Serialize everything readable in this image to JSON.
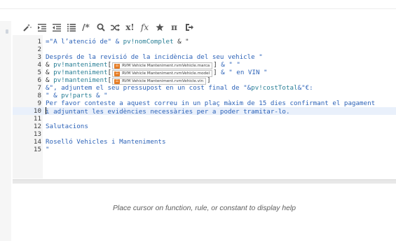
{
  "toolbar": {
    "buttons": [
      {
        "name": "magic-wand-icon",
        "label": ""
      },
      {
        "name": "indent-icon",
        "label": ""
      },
      {
        "name": "outdent-icon",
        "label": ""
      },
      {
        "name": "list-icon",
        "label": ""
      },
      {
        "name": "comment-button",
        "label": "/*"
      },
      {
        "name": "search-icon",
        "label": ""
      },
      {
        "name": "shuffle-icon",
        "label": ""
      },
      {
        "name": "factorial-button",
        "label": "x!"
      },
      {
        "name": "function-button",
        "label": "fx"
      },
      {
        "name": "star-icon",
        "label": ""
      },
      {
        "name": "pi-button",
        "label": "π"
      },
      {
        "name": "insert-icon",
        "label": ""
      }
    ]
  },
  "editor": {
    "line_numbers": [
      "1",
      "2",
      "3",
      "4",
      "5",
      "6",
      "7",
      "8",
      "9",
      "10",
      "11",
      "12",
      "13",
      "14",
      "15"
    ],
    "line1": {
      "open": "=\"A l’atenció de\" & ",
      "var": "pv!nomComplet",
      "tail": " & \""
    },
    "line3": {
      "text": "Després de la revisió de la incidència del seu vehicle \""
    },
    "line4": {
      "amp": "& ",
      "var": "pv!manteniment",
      "open": "[",
      "chip": "RVM Vehicle Manteniment.rvmVehicle.marca",
      "close": "]",
      "tail": " & \" \""
    },
    "line5": {
      "amp": "& ",
      "var": "pv!manteniment",
      "open": "[",
      "chip": "RVM Vehicle Manteniment.rvmVehicle.model",
      "close": "]",
      "tail": " & \" en VIN \""
    },
    "line6": {
      "amp": "& ",
      "var": "pv!manteniment",
      "open": "[",
      "chip": "RVM Vehicle Manteniment.rvmVehicle.vin",
      "close": "]"
    },
    "line7": {
      "a": "&\", adjuntem el seu pressupost en un cost final de \"&",
      "var": "pv!costTotal",
      "b": "&\"€:"
    },
    "line8": {
      "a": "\" & ",
      "var": "pv!parts",
      "b": " & \""
    },
    "line9": {
      "text": "Per favor conteste a aquest correu in un plaç màxim de 15 dies confirmant el pagament"
    },
    "line10": {
      "text": "i adjuntant les evidències necessàries per a poder tramitar-lo."
    },
    "line12": {
      "text": "Salutacions"
    },
    "line14": {
      "text": "Roselló Vehicles i Manteniments"
    },
    "line15": {
      "text": "\""
    },
    "field_icon_glyph": "☷"
  },
  "help": {
    "text": "Place cursor on function, rule, or constant to display help"
  },
  "colors": {
    "string": "#2d63b8",
    "variable": "#2a7f96",
    "active_line": "#e9f0fb",
    "field_icon": "#e57b23"
  }
}
